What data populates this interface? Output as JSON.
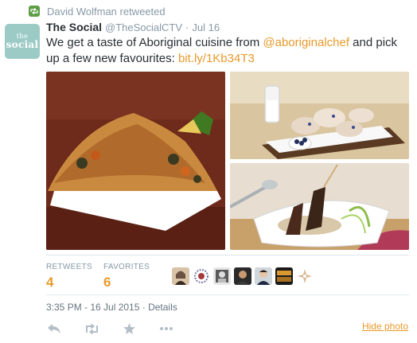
{
  "context": {
    "retweeter_text": "David Wolfman retweeted",
    "icon": "retweet-icon"
  },
  "author": {
    "avatar_line1": "the",
    "avatar_line2": "social",
    "fullname": "The Social",
    "username": "@TheSocialCTV",
    "separator": "·",
    "date": "Jul 16"
  },
  "tweet": {
    "text_before": "We get a taste of Aboriginal cuisine from ",
    "mention": "@aboriginalchef",
    "text_middle": " and pick up a few new favourites: ",
    "link": "bit.ly/1Kb34T3"
  },
  "media": [
    {
      "name": "main-photo",
      "icon": "photo"
    },
    {
      "name": "scones-photo",
      "icon": "photo"
    },
    {
      "name": "skewers-photo",
      "icon": "photo"
    }
  ],
  "stats": {
    "retweets_label": "RETWEETS",
    "retweets_value": "4",
    "favorites_label": "FAVORITES",
    "favorites_value": "6"
  },
  "timestamp": "3:35 PM - 16 Jul 2015 · Details",
  "actions": {
    "reply_icon": "reply-icon",
    "retweet_icon": "retweet-icon",
    "favorite_icon": "star-icon",
    "more_icon": "more-icon",
    "hide_photo_label": "Hide photo"
  },
  "colors": {
    "accent": "#e89a2b",
    "retweet_green": "#5c9e45",
    "muted": "#8899a6",
    "avatar_bg": "#9ccbc6"
  }
}
